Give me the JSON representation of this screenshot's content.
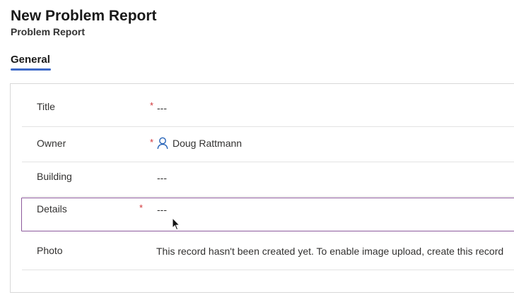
{
  "header": {
    "title": "New Problem Report",
    "subtitle": "Problem Report"
  },
  "tabs": [
    {
      "label": "General",
      "active": true
    }
  ],
  "form": {
    "fields": [
      {
        "label": "Title",
        "required": true,
        "required_mark": "*",
        "value": "---"
      },
      {
        "label": "Owner",
        "required": true,
        "required_mark": "*",
        "value": "Doug Rattmann",
        "icon": "person-icon"
      },
      {
        "label": "Building",
        "required": false,
        "value": "---"
      },
      {
        "label": "Details",
        "required": true,
        "required_mark": "*",
        "value": "---",
        "focused": true
      },
      {
        "label": "Photo",
        "required": false,
        "value": "This record hasn't been created yet. To enable image upload, create this record"
      }
    ]
  },
  "colors": {
    "accent": "#3c69c8",
    "link": "#2563b8",
    "required": "#d13438",
    "focus_border": "#8d5a9c"
  }
}
